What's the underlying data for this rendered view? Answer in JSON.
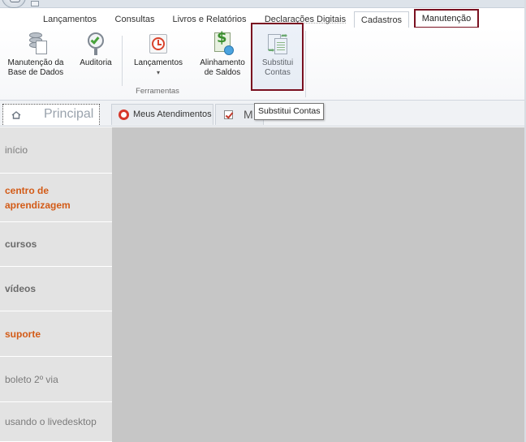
{
  "menu_tabs": [
    "Lançamentos",
    "Consultas",
    "Livros e Relatórios",
    "Declarações Digitais",
    "Cadastros",
    "Manutenção"
  ],
  "ribbon": {
    "buttons": [
      {
        "line1": "Manutenção da",
        "line2": "Base de Dados",
        "icon": "database-icon"
      },
      {
        "line1": "Auditoria",
        "line2": "",
        "icon": "audit-icon"
      },
      {
        "line1": "Lançamentos",
        "line2": "▾",
        "icon": "clock-icon"
      },
      {
        "line1": "Alinhamento",
        "line2": "de Saldos",
        "icon": "money-icon"
      },
      {
        "line1": "Substitui",
        "line2": "Contas",
        "icon": "replace-accounts-icon"
      }
    ],
    "group_label": "Ferramentas"
  },
  "doc_tabs": {
    "principal": "Principal",
    "atendimentos": "Meus Atendimentos",
    "third": "M"
  },
  "tooltip": "Substitui Contas",
  "sidebar": {
    "items": [
      {
        "label": "início",
        "style": "normal"
      },
      {
        "label": "centro de aprendizagem",
        "style": "orange"
      },
      {
        "label": "cursos",
        "style": "bold"
      },
      {
        "label": "vídeos",
        "style": "bold"
      },
      {
        "label": "suporte",
        "style": "orange"
      },
      {
        "label": "boleto 2º via",
        "style": "normal"
      },
      {
        "label": "usando o livedesktop",
        "style": "normal"
      }
    ]
  },
  "colors": {
    "highlight_border": "#7a1020",
    "sidebar_bg": "#e3e3e3",
    "content_bg": "#c6c6c6",
    "orange_text": "#d35b17"
  }
}
